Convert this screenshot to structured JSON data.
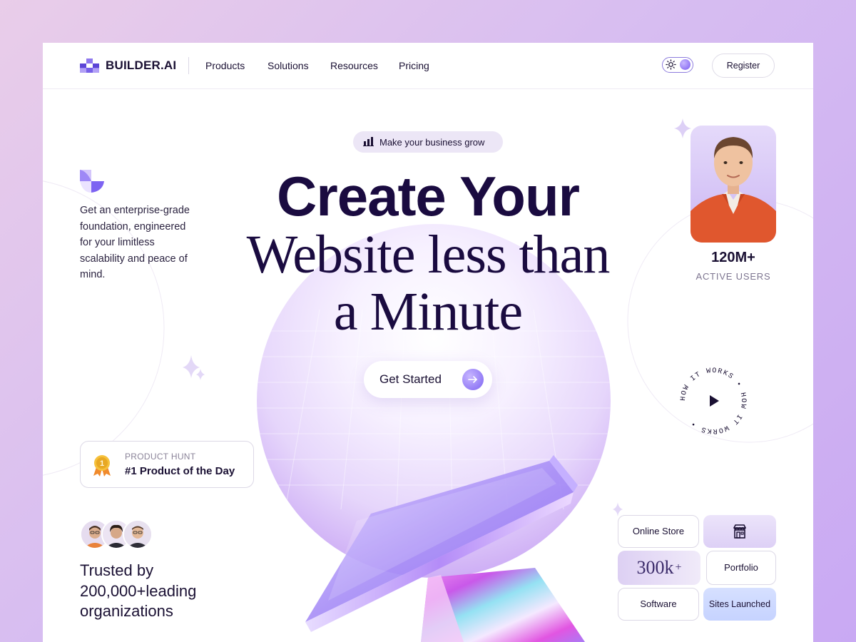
{
  "brand": {
    "name": "BUILDER.AI"
  },
  "nav": {
    "links": [
      "Products",
      "Solutions",
      "Resources",
      "Pricing"
    ],
    "register_label": "Register"
  },
  "intro": {
    "text": "Get an enterprise-grade foundation, engineered for your limitless scalability and peace of mind."
  },
  "hero": {
    "pill_label": "Make your business grow",
    "title_line1": "Create Your",
    "title_line2": "Website less than",
    "title_line3": "a Minute",
    "cta_label": "Get Started"
  },
  "product_hunt": {
    "label": "PRODUCT HUNT",
    "title": "#1 Product of the Day",
    "medal_number": "1"
  },
  "trusted": {
    "text": "Trusted by 200,000+leading organizations"
  },
  "stats": {
    "count": "120M+",
    "label": "ACTIVE USERS"
  },
  "how_it_works": {
    "text": "HOW IT WORKS • HOW IT WORKS •"
  },
  "tiles": {
    "online_store": "Online Store",
    "portfolio": "Portfolio",
    "software": "Software",
    "sites_launched": "Sites Launched",
    "sites_count": "300k",
    "sites_suffix": "+"
  },
  "icons": {
    "theme": "sun-icon",
    "pill": "bar-chart-icon",
    "cta": "arrow-right-icon",
    "medal": "medal-icon",
    "store": "storefront-icon",
    "play": "play-icon"
  },
  "colors": {
    "accent": "#7d63f2",
    "heading": "#1a0b40",
    "background_from": "#e9cde9",
    "background_to": "#c9a9f3",
    "sites_tile": "#c6d3ff"
  }
}
